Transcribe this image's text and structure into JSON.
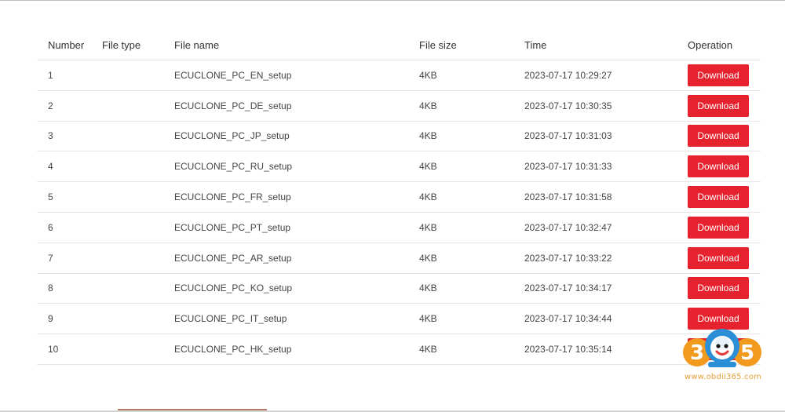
{
  "table": {
    "headers": {
      "number": "Number",
      "file_type": "File type",
      "file_name": "File name",
      "file_size": "File size",
      "time": "Time",
      "operation": "Operation"
    },
    "rows": [
      {
        "number": "1",
        "file_type": "",
        "file_name": "ECUCLONE_PC_EN_setup",
        "file_size": "4KB",
        "time": "2023-07-17 10:29:27",
        "action": "Download"
      },
      {
        "number": "2",
        "file_type": "",
        "file_name": "ECUCLONE_PC_DE_setup",
        "file_size": "4KB",
        "time": "2023-07-17 10:30:35",
        "action": "Download"
      },
      {
        "number": "3",
        "file_type": "",
        "file_name": "ECUCLONE_PC_JP_setup",
        "file_size": "4KB",
        "time": "2023-07-17 10:31:03",
        "action": "Download"
      },
      {
        "number": "4",
        "file_type": "",
        "file_name": "ECUCLONE_PC_RU_setup",
        "file_size": "4KB",
        "time": "2023-07-17 10:31:33",
        "action": "Download"
      },
      {
        "number": "5",
        "file_type": "",
        "file_name": "ECUCLONE_PC_FR_setup",
        "file_size": "4KB",
        "time": "2023-07-17 10:31:58",
        "action": "Download"
      },
      {
        "number": "6",
        "file_type": "",
        "file_name": "ECUCLONE_PC_PT_setup",
        "file_size": "4KB",
        "time": "2023-07-17 10:32:47",
        "action": "Download"
      },
      {
        "number": "7",
        "file_type": "",
        "file_name": "ECUCLONE_PC_AR_setup",
        "file_size": "4KB",
        "time": "2023-07-17 10:33:22",
        "action": "Download"
      },
      {
        "number": "8",
        "file_type": "",
        "file_name": "ECUCLONE_PC_KO_setup",
        "file_size": "4KB",
        "time": "2023-07-17 10:34:17",
        "action": "Download"
      },
      {
        "number": "9",
        "file_type": "",
        "file_name": "ECUCLONE_PC_IT_setup",
        "file_size": "4KB",
        "time": "2023-07-17 10:34:44",
        "action": "Download"
      },
      {
        "number": "10",
        "file_type": "",
        "file_name": "ECUCLONE_PC_HK_setup",
        "file_size": "4KB",
        "time": "2023-07-17 10:35:14",
        "action": "Download"
      }
    ]
  },
  "watermark": {
    "logo_text": "305",
    "url": "www.obdii365.com"
  },
  "colors": {
    "button_bg": "#e6222e",
    "button_text": "#ffffff",
    "row_divider": "#e6e6e6",
    "watermark_orange": "#e8a23a"
  }
}
